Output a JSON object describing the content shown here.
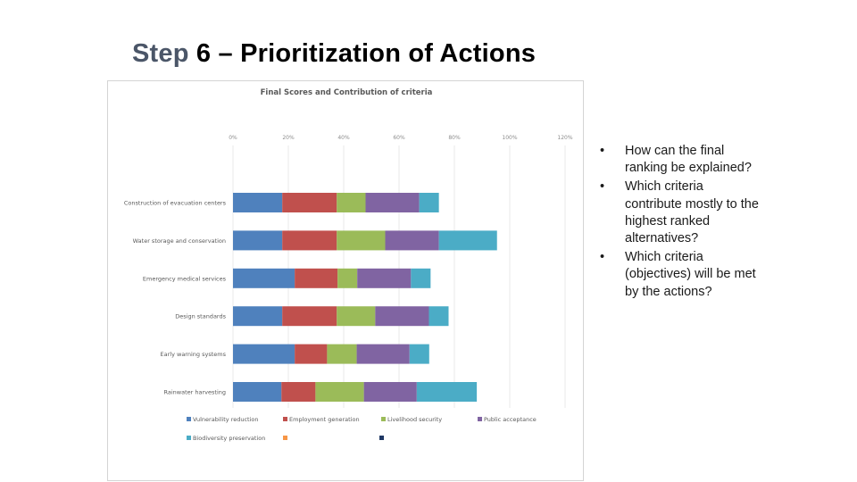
{
  "slide": {
    "title_step": "Step",
    "title_rest": " 6 – Prioritization of Actions"
  },
  "bullets": [
    {
      "marker": "•",
      "text": "How can the final ranking be explained?"
    },
    {
      "marker": "•",
      "text": "Which criteria contribute mostly to the highest ranked alternatives?"
    },
    {
      "marker": "•",
      "text": "Which criteria (objectives) will be met by the actions?"
    }
  ],
  "chart_data": {
    "type": "bar",
    "orientation": "horizontal",
    "stacked": true,
    "title": "Final Scores and Contribution of criteria",
    "xlabel": "",
    "ylabel": "",
    "xlim": [
      0,
      120
    ],
    "x_ticks": [
      "0%",
      "20%",
      "40%",
      "60%",
      "80%",
      "100%",
      "120%"
    ],
    "x_axis_position": "top",
    "grid": true,
    "legend_position": "bottom",
    "categories": [
      "Construction of evacuation centers",
      "Water storage and conservation",
      "Emergency medical services",
      "Design standards",
      "Early warning systems",
      "Rainwater harvesting"
    ],
    "series": [
      {
        "name": "Vulnerability reduction",
        "color": "#4f81bd",
        "values": [
          17.8,
          17.8,
          22.3,
          17.8,
          22.3,
          17.5
        ]
      },
      {
        "name": "Employment generation",
        "color": "#c0504d",
        "values": [
          19.7,
          19.7,
          15.5,
          19.7,
          11.7,
          12.3
        ]
      },
      {
        "name": "Livelihood security",
        "color": "#9bbb59",
        "values": [
          10.4,
          17.5,
          7.1,
          13.9,
          10.7,
          17.5
        ]
      },
      {
        "name": "Public acceptance",
        "color": "#8064a2",
        "values": [
          19.4,
          19.4,
          19.4,
          19.4,
          19.1,
          19.1
        ]
      },
      {
        "name": "Biodiversity preservation",
        "color": "#4bacc6",
        "values": [
          7.1,
          21.0,
          7.1,
          7.1,
          7.1,
          21.7
        ]
      },
      {
        "name": "",
        "color": "#f79646",
        "values": [
          0,
          0,
          0,
          0,
          0,
          0
        ]
      },
      {
        "name": "",
        "color": "#1f3864",
        "values": [
          0,
          0,
          0,
          0,
          0,
          0
        ]
      }
    ]
  }
}
